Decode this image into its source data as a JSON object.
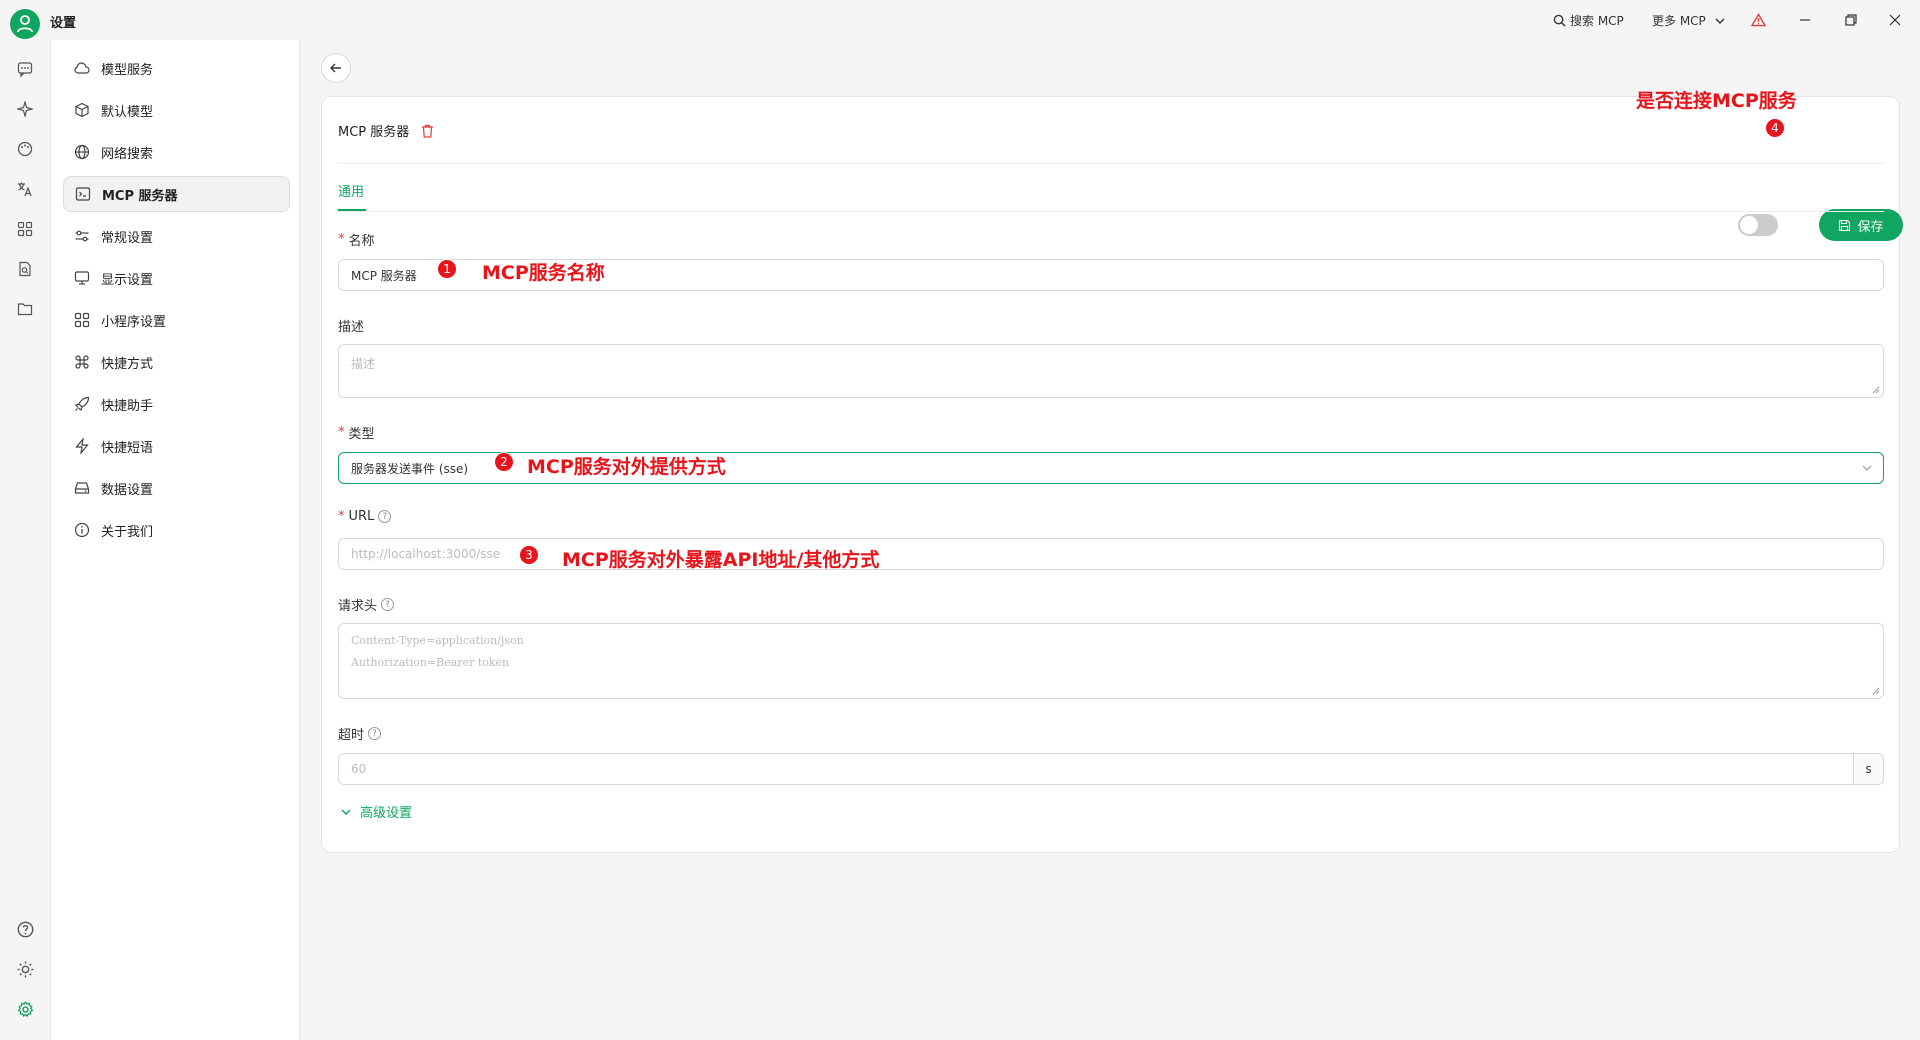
{
  "app": {
    "title": "设置"
  },
  "titlebar": {
    "search_mcp": "搜索 MCP",
    "more_mcp": "更多 MCP"
  },
  "nav": {
    "items": [
      {
        "label": "模型服务",
        "icon": "cloud-icon"
      },
      {
        "label": "默认模型",
        "icon": "cube-icon"
      },
      {
        "label": "网络搜索",
        "icon": "globe-icon"
      },
      {
        "label": "MCP 服务器",
        "icon": "terminal-icon",
        "active": true
      },
      {
        "label": "常规设置",
        "icon": "sliders-icon"
      },
      {
        "label": "显示设置",
        "icon": "monitor-icon"
      },
      {
        "label": "小程序设置",
        "icon": "grid-icon"
      },
      {
        "label": "快捷方式",
        "icon": "command-icon"
      },
      {
        "label": "快捷助手",
        "icon": "rocket-icon"
      },
      {
        "label": "快捷短语",
        "icon": "zap-icon"
      },
      {
        "label": "数据设置",
        "icon": "hard-drive-icon"
      },
      {
        "label": "关于我们",
        "icon": "info-icon"
      }
    ]
  },
  "server": {
    "title": "MCP 服务器",
    "save_label": "保存",
    "tab_general": "通用",
    "enabled": false
  },
  "form": {
    "name": {
      "label": "名称",
      "value": "MCP 服务器"
    },
    "description": {
      "label": "描述",
      "placeholder": "描述"
    },
    "type": {
      "label": "类型",
      "value": "服务器发送事件 (sse)"
    },
    "url": {
      "label": "URL",
      "placeholder": "http://localhost:3000/sse"
    },
    "headers": {
      "label": "请求头",
      "placeholder_line1": "Content-Type=application/json",
      "placeholder_line2": "Authorization=Bearer token"
    },
    "timeout": {
      "label": "超时",
      "placeholder": "60",
      "suffix": "s"
    },
    "advanced_label": "高级设置"
  },
  "annotations": {
    "a1": {
      "num": "1",
      "text": "MCP服务名称"
    },
    "a2": {
      "num": "2",
      "text": "MCP服务对外提供方式"
    },
    "a3": {
      "num": "3",
      "text": "MCP服务对外暴露API地址/其他方式"
    },
    "a4": {
      "num": "4",
      "text": "是否连接MCP服务"
    }
  },
  "colors": {
    "accent": "#10a561",
    "annotation": "#e8141b",
    "required": "#e53935"
  }
}
